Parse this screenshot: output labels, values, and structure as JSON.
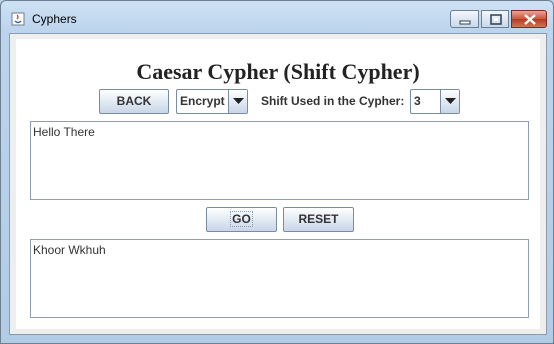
{
  "window": {
    "title": "Cyphers",
    "app_icon": "java-icon"
  },
  "heading": "Caesar Cypher (Shift Cypher)",
  "controls": {
    "back_label": "BACK",
    "mode_value": "Encrypt",
    "shift_label": "Shift Used in the Cypher:",
    "shift_value": "3",
    "go_label": "GO",
    "reset_label": "RESET"
  },
  "input_text": "Hello There",
  "output_text": "Khoor Wkhuh",
  "colors": {
    "title_bar": "#bcd4ec",
    "button_border": "#7a8ca3",
    "close_button": "#c9553a"
  }
}
